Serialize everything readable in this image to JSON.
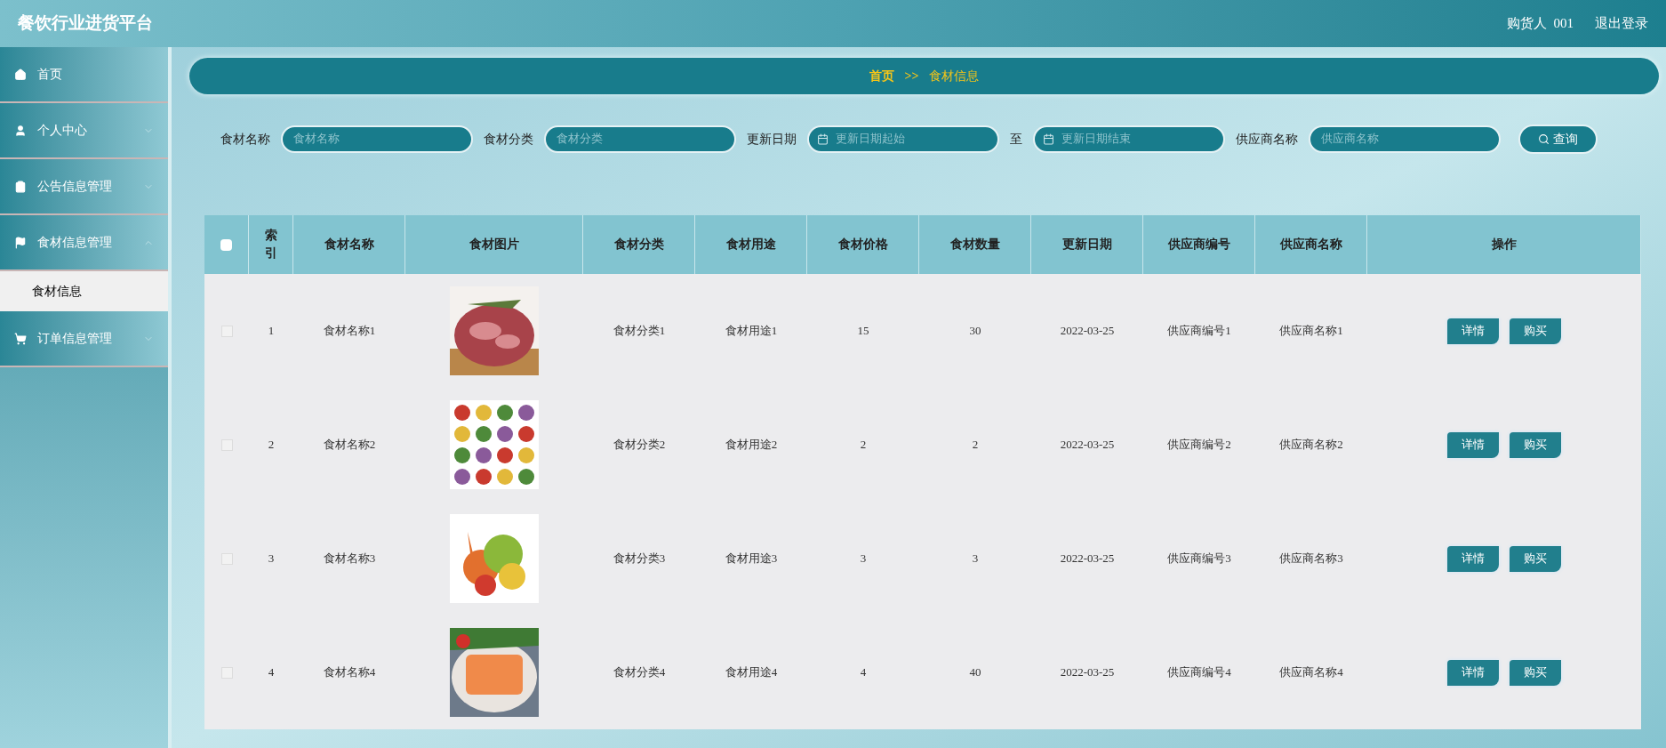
{
  "header": {
    "title": "餐饮行业进货平台",
    "user_label": "购货人",
    "user_name": "001",
    "logout": "退出登录"
  },
  "sidebar": {
    "items": [
      {
        "label": "首页",
        "kind": "link"
      },
      {
        "label": "个人中心",
        "kind": "group",
        "expanded": false
      },
      {
        "label": "公告信息管理",
        "kind": "group",
        "expanded": false
      },
      {
        "label": "食材信息管理",
        "kind": "group",
        "expanded": true,
        "children": [
          {
            "label": "食材信息",
            "selected": true
          }
        ]
      },
      {
        "label": "订单信息管理",
        "kind": "group",
        "expanded": false
      }
    ]
  },
  "breadcrumb": {
    "home": "首页",
    "separator": ">>",
    "current": "食材信息"
  },
  "search": {
    "fields": [
      {
        "label": "食材名称",
        "placeholder": "食材名称",
        "kind": "text"
      },
      {
        "label": "食材分类",
        "placeholder": "食材分类",
        "kind": "text"
      },
      {
        "label": "更新日期",
        "placeholder": "更新日期起始",
        "kind": "date"
      },
      {
        "label": "至",
        "placeholder": "更新日期结束",
        "kind": "date"
      },
      {
        "label": "供应商名称",
        "placeholder": "供应商名称",
        "kind": "text"
      }
    ],
    "button": "查询"
  },
  "table": {
    "all_checked": false,
    "columns": [
      "索引",
      "食材名称",
      "食材图片",
      "食材分类",
      "食材用途",
      "食材价格",
      "食材数量",
      "更新日期",
      "供应商编号",
      "供应商名称",
      "操作"
    ],
    "rows": [
      {
        "checked": false,
        "index": "1",
        "name": "食材名称1",
        "category": "食材分类1",
        "use": "食材用途1",
        "price": "15",
        "quantity": "30",
        "date": "2022-03-25",
        "supplier_no": "供应商编号1",
        "supplier_name": "供应商名称1",
        "actions": [
          "详情",
          "购买"
        ]
      },
      {
        "checked": false,
        "index": "2",
        "name": "食材名称2",
        "category": "食材分类2",
        "use": "食材用途2",
        "price": "2",
        "quantity": "2",
        "date": "2022-03-25",
        "supplier_no": "供应商编号2",
        "supplier_name": "供应商名称2",
        "actions": [
          "详情",
          "购买"
        ]
      },
      {
        "checked": false,
        "index": "3",
        "name": "食材名称3",
        "category": "食材分类3",
        "use": "食材用途3",
        "price": "3",
        "quantity": "3",
        "date": "2022-03-25",
        "supplier_no": "供应商编号3",
        "supplier_name": "供应商名称3",
        "actions": [
          "详情",
          "购买"
        ]
      },
      {
        "checked": false,
        "index": "4",
        "name": "食材名称4",
        "category": "食材分类4",
        "use": "食材用途4",
        "price": "4",
        "quantity": "40",
        "date": "2022-03-25",
        "supplier_no": "供应商编号4",
        "supplier_name": "供应商名称4",
        "actions": [
          "详情",
          "购买"
        ]
      }
    ]
  }
}
